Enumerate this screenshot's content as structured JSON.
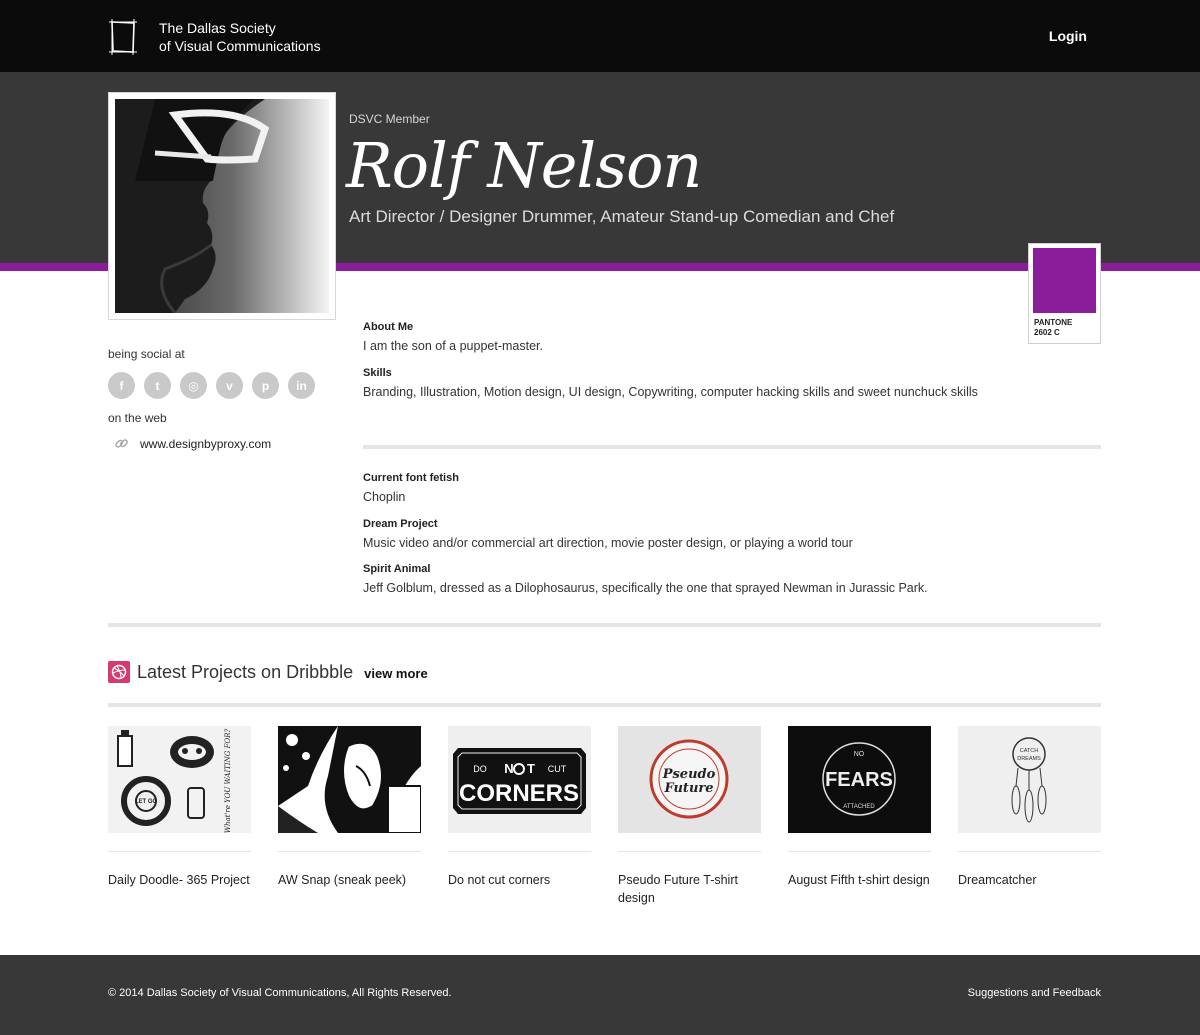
{
  "header": {
    "org_line1": "The Dallas Society",
    "org_line2": "of Visual Communications",
    "login_label": "Login"
  },
  "profile": {
    "member_label": "DSVC Member",
    "name": "Rolf Nelson",
    "title": "Art Director / Designer Drummer, Amateur Stand-up Comedian and Chef",
    "avatar_icon": "profile-photo",
    "pantone_color": "#8b1d9a",
    "pantone_line1": "PANTONE",
    "pantone_line2": "2602 C"
  },
  "sidebar": {
    "social_label": "being social at",
    "social_icons": [
      {
        "name": "facebook-icon",
        "glyph": "f"
      },
      {
        "name": "twitter-icon",
        "glyph": "t"
      },
      {
        "name": "instagram-icon",
        "glyph": "◎"
      },
      {
        "name": "vimeo-icon",
        "glyph": "v"
      },
      {
        "name": "pinterest-icon",
        "glyph": "p"
      },
      {
        "name": "linkedin-icon",
        "glyph": "in"
      }
    ],
    "web_label": "on the web",
    "website": "www.designbyproxy.com"
  },
  "about": {
    "about_label": "About Me",
    "about_value": "I am the son of a puppet-master.",
    "skills_label": "Skills",
    "skills_value": "Branding, Illustration, Motion design, UI design, Copywriting, computer hacking skills and sweet nunchuck skills",
    "font_label": "Current font fetish",
    "font_value": "Choplin",
    "dream_label": "Dream Project",
    "dream_value": "Music video and/or commercial art direction, movie poster design, or playing a world tour",
    "spirit_label": "Spirit Animal",
    "spirit_value": "Jeff Golblum, dressed as a Dilophosaurus, specifically the one that sprayed Newman in Jurassic Park."
  },
  "projects": {
    "heading": "Latest Projects on Dribbble",
    "view_more": "view more",
    "items": [
      {
        "title": "Daily Doodle- 365 Project",
        "bg": "#f2f2f2"
      },
      {
        "title": "AW Snap (sneak peek)",
        "bg": "#ffffff"
      },
      {
        "title": "Do not cut corners",
        "bg": "#efefef"
      },
      {
        "title": "Pseudo Future T-shirt design",
        "bg": "#e4e4e4"
      },
      {
        "title": "August Fifth t-shirt design",
        "bg": "#0d0d0d"
      },
      {
        "title": "Dreamcatcher",
        "bg": "#efefef"
      }
    ],
    "thumb_texts": {
      "p1_a": "LET GO",
      "p1_b": "What're YOU WAITING FOR?",
      "p3_a": "DO",
      "p3_b": "N",
      "p3_c": "T",
      "p3_d": "CUT",
      "p3_e": "CORNERS",
      "p4_a": "Pseudo",
      "p4_b": "Future",
      "p5_a": "NO",
      "p5_b": "FEARS",
      "p5_c": "ATTACHED",
      "p6_a": "CATCH",
      "p6_b": "DREAMS"
    }
  },
  "footer": {
    "copyright": "© 2014 Dallas Society of Visual Communications, All Rights Reserved.",
    "feedback": "Suggestions and Feedback"
  }
}
